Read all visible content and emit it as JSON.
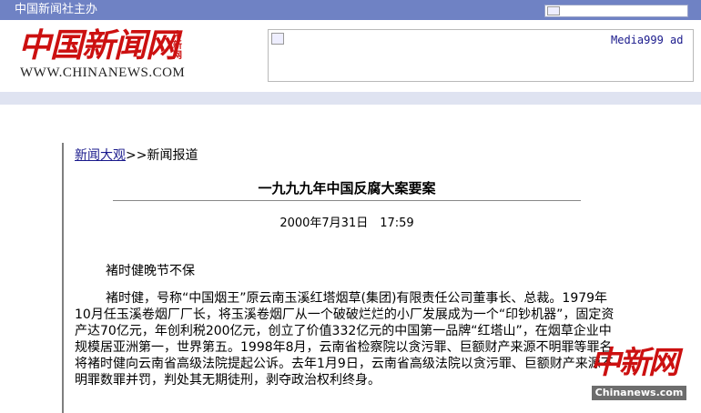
{
  "header": {
    "host_text": "中国新闻社主办",
    "logo_cn": "中国新闻网",
    "logo_side": "中新网",
    "logo_en": "WWW.CHINANEWS.COM"
  },
  "ad": {
    "text": "Media999 ad"
  },
  "breadcrumb": {
    "link": "新闻大观",
    "separator": ">>",
    "current": "新闻报道"
  },
  "article": {
    "title": "一九九九年中国反腐大案要案",
    "datetime": "2000年7月31日　17:59",
    "subhead": "褚时健晚节不保",
    "body": "褚时健，号称“中国烟王”原云南玉溪红塔烟草(集团)有限责任公司董事长、总裁。1979年10月任玉溪卷烟厂厂长，将玉溪卷烟厂从一个破破烂烂的小厂发展成为一个“印钞机器”，固定资产达70亿元，年创利税200亿元，创立了价值332亿元的中国第一品牌“红塔山”，在烟草企业中规模居亚洲第一，世界第五。1998年8月，云南省检察院以贪污罪、巨额财产来源不明罪等罪名将褚时健向云南省高级法院提起公诉。去年1月9日，云南省高级法院以贪污罪、巨额财产来源不明罪数罪并罚，判处其无期徒刑，剥夺政治权利终身。"
  },
  "watermark": {
    "cn": "中新网",
    "en": "Chinanews.com"
  },
  "colors": {
    "topbar": "#6f82c4",
    "band": "#dfe3f1",
    "logo_red": "#cc1010",
    "link": "#1a1a8c"
  }
}
